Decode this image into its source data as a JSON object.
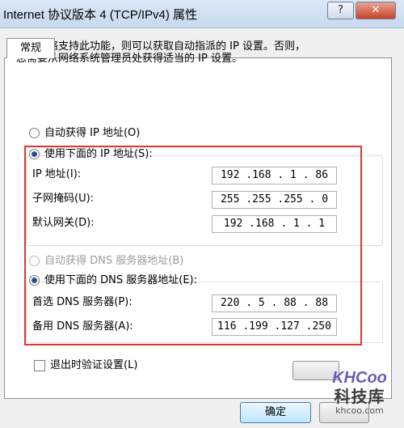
{
  "window": {
    "title": "Internet 协议版本 4 (TCP/IPv4) 属性",
    "help_label": "?",
    "close_label": "✕"
  },
  "tab": {
    "label": "常规"
  },
  "description": "如果网络支持此功能，则可以获取自动指派的 IP 设置。否则，\n您需要从网络系统管理员处获得适当的 IP 设置。",
  "ip_section": {
    "auto_label": "自动获得 IP 地址(O)",
    "manual_label": "使用下面的 IP 地址(S):",
    "auto_selected": false,
    "fields": [
      {
        "label": "IP 地址(I):",
        "value": "192 .168 . 1 . 86"
      },
      {
        "label": "子网掩码(U):",
        "value": "255 .255 .255 . 0"
      },
      {
        "label": "默认网关(D):",
        "value": "192 .168 . 1 . 1"
      }
    ]
  },
  "dns_section": {
    "auto_label": "自动获得 DNS 服务器地址(B)",
    "manual_label": "使用下面的 DNS 服务器地址(E):",
    "fields": [
      {
        "label": "首选 DNS 服务器(P):",
        "value": "220 . 5 . 88 . 88"
      },
      {
        "label": "备用 DNS 服务器(A):",
        "value": "116 .199 .127 .250"
      }
    ]
  },
  "validate": {
    "label": "退出时验证设置(L)",
    "checked": false
  },
  "buttons": {
    "ok_label": "确定"
  },
  "watermark": {
    "logo": "KHCoo",
    "name": "科技库",
    "url": "khcoo.com"
  },
  "colors": {
    "highlight": "#e0362f",
    "selection": "#2b4f8a"
  }
}
